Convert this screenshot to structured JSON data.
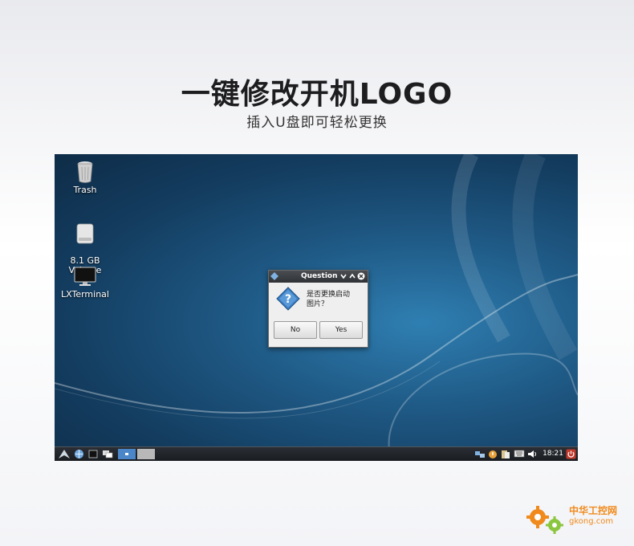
{
  "headline": "一键修改开机LOGO",
  "subheadline": "插入U盘即可轻松更换",
  "desktop": {
    "icons": [
      {
        "label": "Trash",
        "icon": "trash-icon"
      },
      {
        "label": "8.1 GB\nVolume",
        "icon": "drive-icon"
      },
      {
        "label": "LXTerminal",
        "icon": "monitor-icon"
      }
    ]
  },
  "dialog": {
    "title": "Question",
    "message_line1": "是否更换启动",
    "message_line2": "图片？",
    "no_label": "No",
    "yes_label": "Yes",
    "icon": "question-icon"
  },
  "taskbar": {
    "clock": "18:21"
  },
  "watermark": {
    "cn": "中华工控网",
    "en": "gkong.com"
  },
  "colors": {
    "desktop_bg": "#1f5a86",
    "taskbar_bg": "#1a1d21",
    "watermark_orange": "#f08a1c"
  }
}
